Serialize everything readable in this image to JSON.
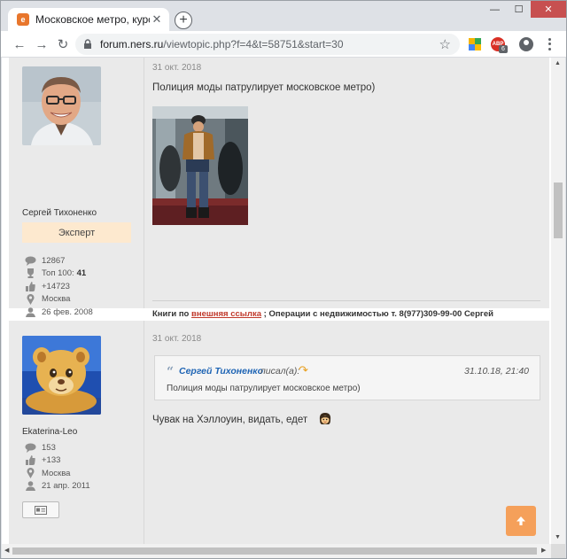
{
  "browser": {
    "tab_title": "Московское метро, курс выживания",
    "url_host": "forum.ners.ru",
    "url_path": "/viewtopic.php?f=4&t=58751&start=30",
    "extension_badge": "6",
    "extension_label": "ABP"
  },
  "posts": [
    {
      "author": "Сергей Тихоненко",
      "rank": "Эксперт",
      "stats": {
        "messages": "12867",
        "top_label": "Топ 100:",
        "top_value": "41",
        "likes": "+14723",
        "location": "Москва",
        "joined": "26 фев. 2008"
      },
      "date": "31 окт. 2018",
      "text": "Полиция моды патрулирует московское метро)",
      "signature": {
        "prefix": "Книги по ",
        "link": "внешняя ссылка",
        "suffix": " ; Операции с недвижимостью т. 8(977)309-99-00 Сергей"
      }
    },
    {
      "author": "Ekaterina-Leo",
      "stats": {
        "messages": "153",
        "likes": "+133",
        "location": "Москва",
        "joined": "21 апр. 2011"
      },
      "date": "31 окт. 2018",
      "quote": {
        "author": "Сергей Тихоненко",
        "wrote": "писал(а):",
        "datetime": "31.10.18, 21:40",
        "text": "Полиция моды патрулирует московское метро)"
      },
      "text": "Чувак на Хэллоуин, видать, едет"
    }
  ]
}
